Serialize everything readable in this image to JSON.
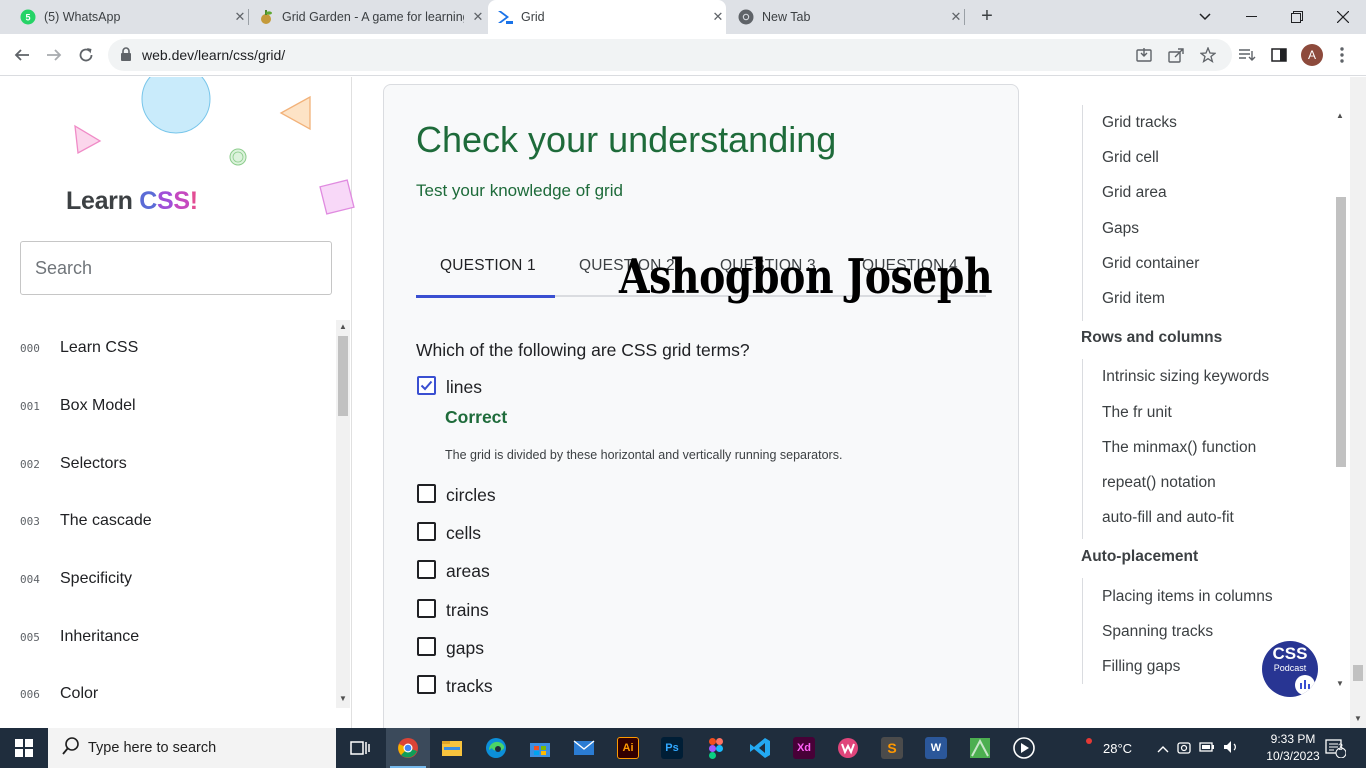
{
  "browser": {
    "tabs": [
      {
        "title": "(5) WhatsApp",
        "favicon": "whatsapp-icon"
      },
      {
        "title": "Grid Garden - A game for learning CSS grid",
        "favicon": "grid-garden-icon"
      },
      {
        "title": "Grid",
        "favicon": "webdev-icon"
      },
      {
        "title": "New Tab",
        "favicon": "chrome-icon"
      }
    ],
    "whatsapp_badge": "5",
    "url": "web.dev/learn/css/grid/",
    "avatar_letter": "A"
  },
  "sidebar": {
    "brand_prefix": "Learn ",
    "brand_letters": [
      "C",
      "S",
      "S",
      "!"
    ],
    "search_placeholder": "Search",
    "items": [
      {
        "num": "000",
        "label": "Learn CSS"
      },
      {
        "num": "001",
        "label": "Box Model"
      },
      {
        "num": "002",
        "label": "Selectors"
      },
      {
        "num": "003",
        "label": "The cascade"
      },
      {
        "num": "004",
        "label": "Specificity"
      },
      {
        "num": "005",
        "label": "Inheritance"
      },
      {
        "num": "006",
        "label": "Color"
      }
    ]
  },
  "assessment": {
    "title": "Check your understanding",
    "subtitle": "Test your knowledge of grid",
    "tabs": [
      "QUESTION 1",
      "QUESTION 2",
      "QUESTION 3",
      "QUESTION 4"
    ],
    "active_tab": 0,
    "question": "Which of the following are CSS grid terms?",
    "options": [
      {
        "label": "lines",
        "checked": true
      },
      {
        "label": "circles",
        "checked": false
      },
      {
        "label": "cells",
        "checked": false
      },
      {
        "label": "areas",
        "checked": false
      },
      {
        "label": "trains",
        "checked": false
      },
      {
        "label": "gaps",
        "checked": false
      },
      {
        "label": "tracks",
        "checked": false
      }
    ],
    "result": "Correct",
    "feedback": "The grid is divided by these horizontal and vertically running separators."
  },
  "watermark": "Ashogbon Joseph",
  "toc": {
    "group1": [
      "Grid tracks",
      "Grid cell",
      "Grid area",
      "Gaps",
      "Grid container",
      "Grid item"
    ],
    "heading2": "Rows and columns",
    "group2": [
      "Intrinsic sizing keywords",
      "The fr unit",
      "The minmax() function",
      "repeat() notation",
      "auto-fill and auto-fit"
    ],
    "heading3": "Auto-placement",
    "group3": [
      "Placing items in columns",
      "Spanning tracks",
      "Filling gaps"
    ]
  },
  "podcast": {
    "title": "CSS",
    "subtitle": "Podcast"
  },
  "taskbar": {
    "search_placeholder": "Type here to search",
    "weather": "28°C",
    "time": "9:33 PM",
    "date": "10/3/2023",
    "notification_count": "3"
  },
  "colors": {
    "accent_green": "#1e6b3a",
    "accent_blue": "#3a4fd1",
    "taskbar": "#1f2d3d"
  }
}
